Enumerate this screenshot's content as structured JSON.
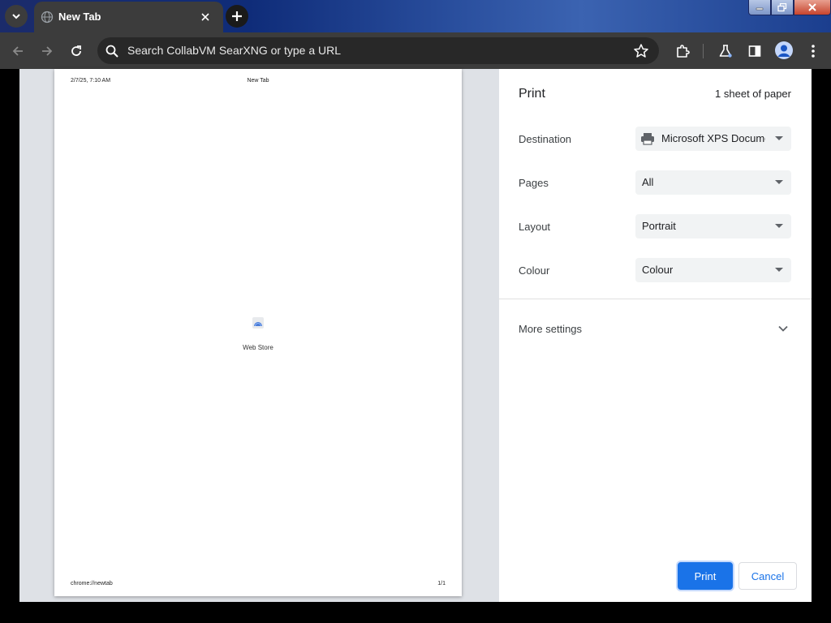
{
  "tabs": [
    {
      "title": "New Tab",
      "active": true
    }
  ],
  "toolbar": {
    "omnibox_placeholder": "Search CollabVM SearXNG or type a URL"
  },
  "icons": {
    "tab_search": "chevron-down-icon",
    "tab_close": "close-icon",
    "new_tab": "plus-icon",
    "back": "arrow-left-icon",
    "forward": "arrow-right-icon",
    "reload": "reload-icon",
    "search": "search-icon",
    "bookmark": "star-icon",
    "extensions": "puzzle-icon",
    "labs": "flask-icon",
    "side_panel": "side-panel-icon",
    "profile": "profile-icon",
    "menu": "kebab-menu-icon"
  },
  "preview": {
    "header_date": "2/7/25, 7:10 AM",
    "header_title": "New Tab",
    "center_label": "Web Store",
    "footer_url": "chrome://newtab",
    "footer_page": "1/1"
  },
  "print": {
    "title": "Print",
    "sheet_count": "1 sheet of paper",
    "settings": [
      {
        "label": "Destination",
        "value": "Microsoft XPS Docume"
      },
      {
        "label": "Pages",
        "value": "All"
      },
      {
        "label": "Layout",
        "value": "Portrait"
      },
      {
        "label": "Colour",
        "value": "Colour"
      }
    ],
    "more_settings": "More settings",
    "print_button": "Print",
    "cancel_button": "Cancel"
  },
  "colors": {
    "accent": "#1a73e8",
    "toolbar_bg": "#3c3c3c",
    "preview_bg": "#dee1e6"
  }
}
